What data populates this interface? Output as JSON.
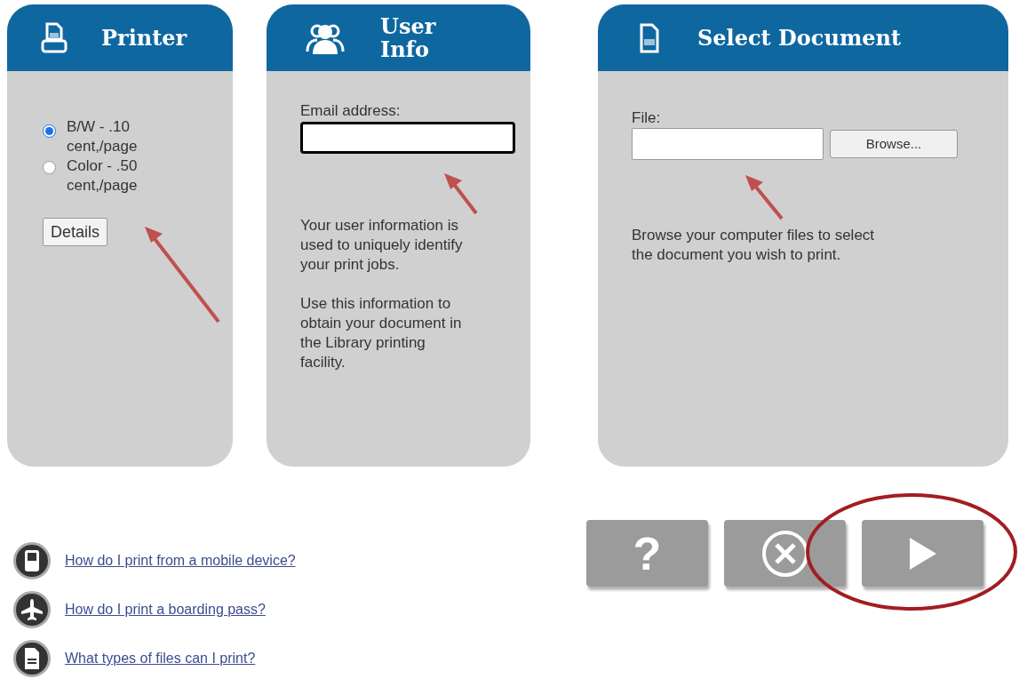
{
  "printer": {
    "title": "Printer",
    "options": [
      {
        "label": "B/W - .10 cent,/page",
        "selected": true
      },
      {
        "label": "Color - .50 cent,/page",
        "selected": false
      }
    ],
    "details_button": "Details"
  },
  "user_info": {
    "title": "User Info",
    "email_label": "Email address:",
    "paragraphs": [
      "Your user information is used to uniquely identify your print jobs.",
      "Use this information to obtain your document in the Library printing facility."
    ]
  },
  "select_document": {
    "title": "Select Document",
    "file_label": "File:",
    "browse_button": "Browse...",
    "description": "Browse your computer files to select the document you wish to print."
  },
  "help_links": [
    {
      "kind": "mobile",
      "label": "How do I print from a mobile device?"
    },
    {
      "kind": "plane",
      "label": "How do I print a boarding pass?"
    },
    {
      "kind": "document",
      "label": "What types of files can I print?"
    }
  ],
  "actions": [
    {
      "kind": "help",
      "label": "?"
    },
    {
      "kind": "cancel"
    },
    {
      "kind": "next"
    }
  ]
}
